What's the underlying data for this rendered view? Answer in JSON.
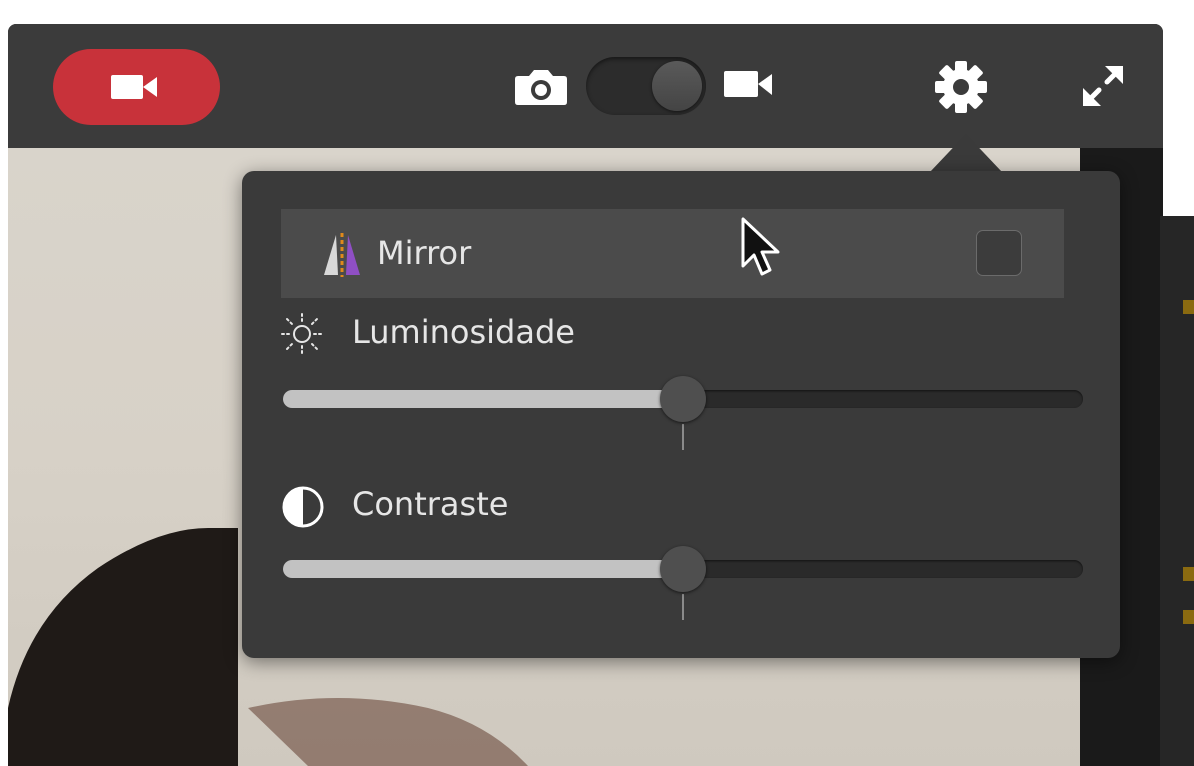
{
  "toolbar": {
    "record_icon": "video-camera-icon",
    "mode_photo_icon": "camera-icon",
    "mode_video_icon": "video-camera-icon",
    "settings_icon": "gear-icon",
    "fullscreen_icon": "expand-icon",
    "record_color": "#c8323a"
  },
  "settings": {
    "mirror": {
      "label": "Mirror",
      "icon": "mirror-icon",
      "checked": false
    },
    "brightness": {
      "label": "Luminosidade",
      "icon": "sun-icon",
      "value_fraction": 0.5
    },
    "contrast": {
      "label": "Contraste",
      "icon": "contrast-icon",
      "value_fraction": 0.5
    }
  }
}
